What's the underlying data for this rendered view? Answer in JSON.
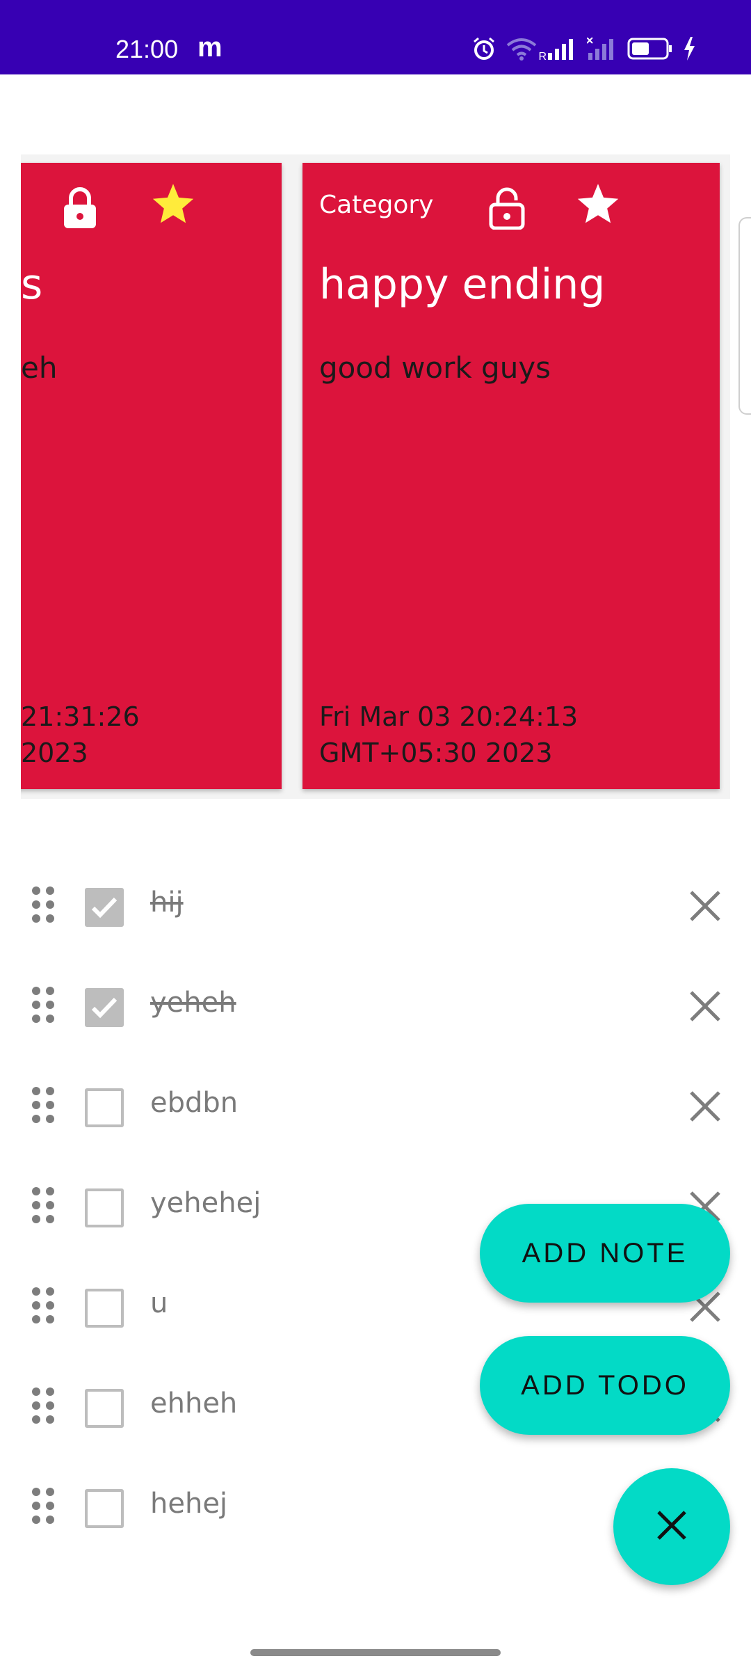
{
  "status_bar": {
    "time": "21:00",
    "app_badge": "m",
    "roaming_label": "R",
    "icons": [
      "alarm-icon",
      "wifi-icon",
      "signal-icon",
      "signal-off-icon",
      "battery-icon",
      "charging-icon"
    ]
  },
  "cards": [
    {
      "title_fragment": "s",
      "body_fragment": "eh",
      "date_line1": "21:31:26",
      "date_line2": "2023",
      "locked": true,
      "starred": true,
      "color": "#dc143c"
    },
    {
      "category": "Category",
      "title": "happy ending",
      "body": "good work guys",
      "date": "Fri Mar 03 20:24:13 GMT+05:30 2023",
      "locked": false,
      "starred": false,
      "color": "#dc143c"
    }
  ],
  "todos": [
    {
      "text": "hij",
      "checked": true
    },
    {
      "text": "yeheh",
      "checked": true
    },
    {
      "text": "ebdbn",
      "checked": false
    },
    {
      "text": "yehehej",
      "checked": false
    },
    {
      "text": "u",
      "checked": false
    },
    {
      "text": "ehheh",
      "checked": false
    },
    {
      "text": "hehej",
      "checked": false
    }
  ],
  "fabs": {
    "add_note": "ADD NOTE",
    "add_todo": "ADD TODO",
    "main_icon": "close-icon"
  },
  "colors": {
    "status_bar": "#3700b3",
    "card": "#dc143c",
    "fab": "#03dac6",
    "star_active": "#ffeb3b"
  }
}
